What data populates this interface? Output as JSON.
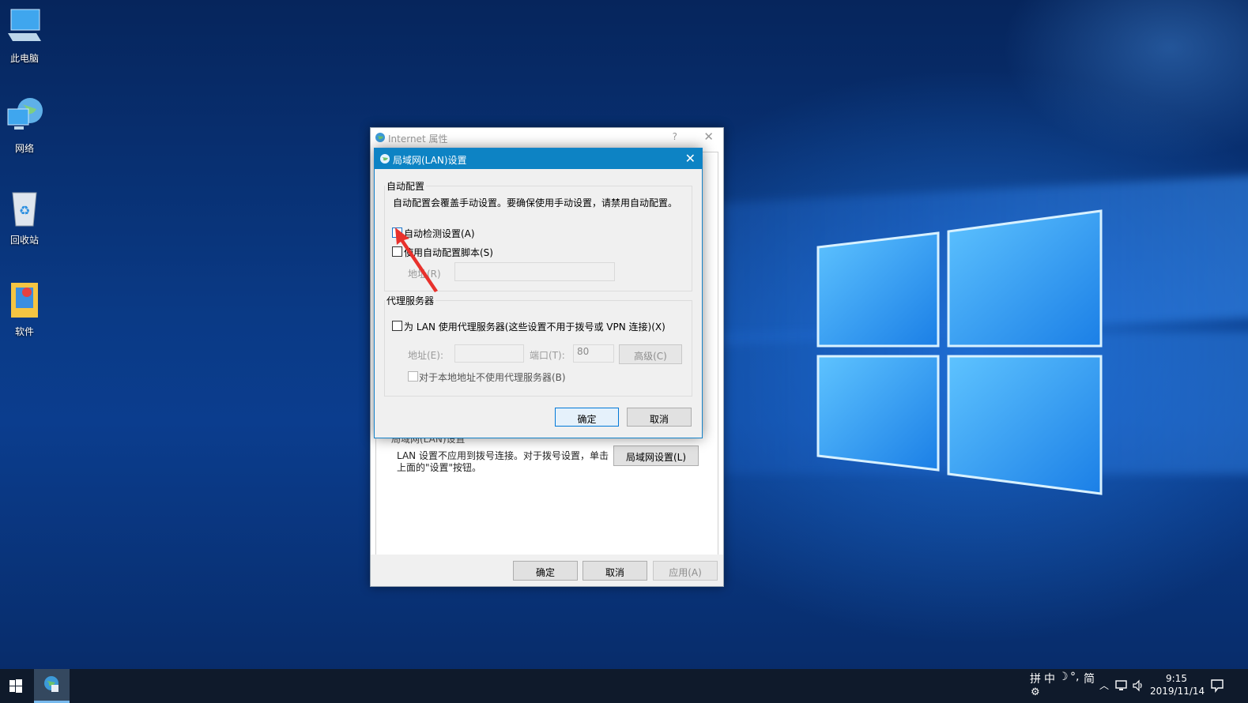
{
  "desktop": {
    "icons": [
      {
        "label": "此电脑"
      },
      {
        "label": "网络"
      },
      {
        "label": "回收站"
      },
      {
        "label": "软件"
      }
    ]
  },
  "inet_window": {
    "title": "Internet 属性",
    "help": "?",
    "close": "✕",
    "lan_group_label": "局域网(LAN)设置",
    "lan_desc": "LAN 设置不应用到拨号连接。对于拨号设置，单击上面的\"设置\"按钮。",
    "lan_settings_button": "局域网设置(L)",
    "ok": "确定",
    "cancel": "取消",
    "apply": "应用(A)"
  },
  "lan_dialog": {
    "title": "局域网(LAN)设置",
    "close": "✕",
    "auto_config": {
      "group_label": "自动配置",
      "description": "自动配置会覆盖手动设置。要确保使用手动设置，请禁用自动配置。",
      "auto_detect_label": "自动检测设置(A)",
      "auto_detect_checked": false,
      "use_script_label": "使用自动配置脚本(S)",
      "use_script_checked": false,
      "address_label": "地址(R)",
      "address_value": ""
    },
    "proxy": {
      "group_label": "代理服务器",
      "use_proxy_label": "为 LAN 使用代理服务器(这些设置不用于拨号或 VPN 连接)(X)",
      "use_proxy_checked": false,
      "address_label": "地址(E):",
      "address_value": "",
      "port_label": "端口(T):",
      "port_value": "80",
      "advanced_button": "高级(C)",
      "bypass_local_label": "对于本地地址不使用代理服务器(B)",
      "bypass_local_checked": false
    },
    "ok": "确定",
    "cancel": "取消"
  },
  "taskbar": {
    "ime": [
      "拼",
      "中",
      "☽",
      "°,",
      "简"
    ],
    "time": "9:15",
    "date": "2019/11/14"
  }
}
